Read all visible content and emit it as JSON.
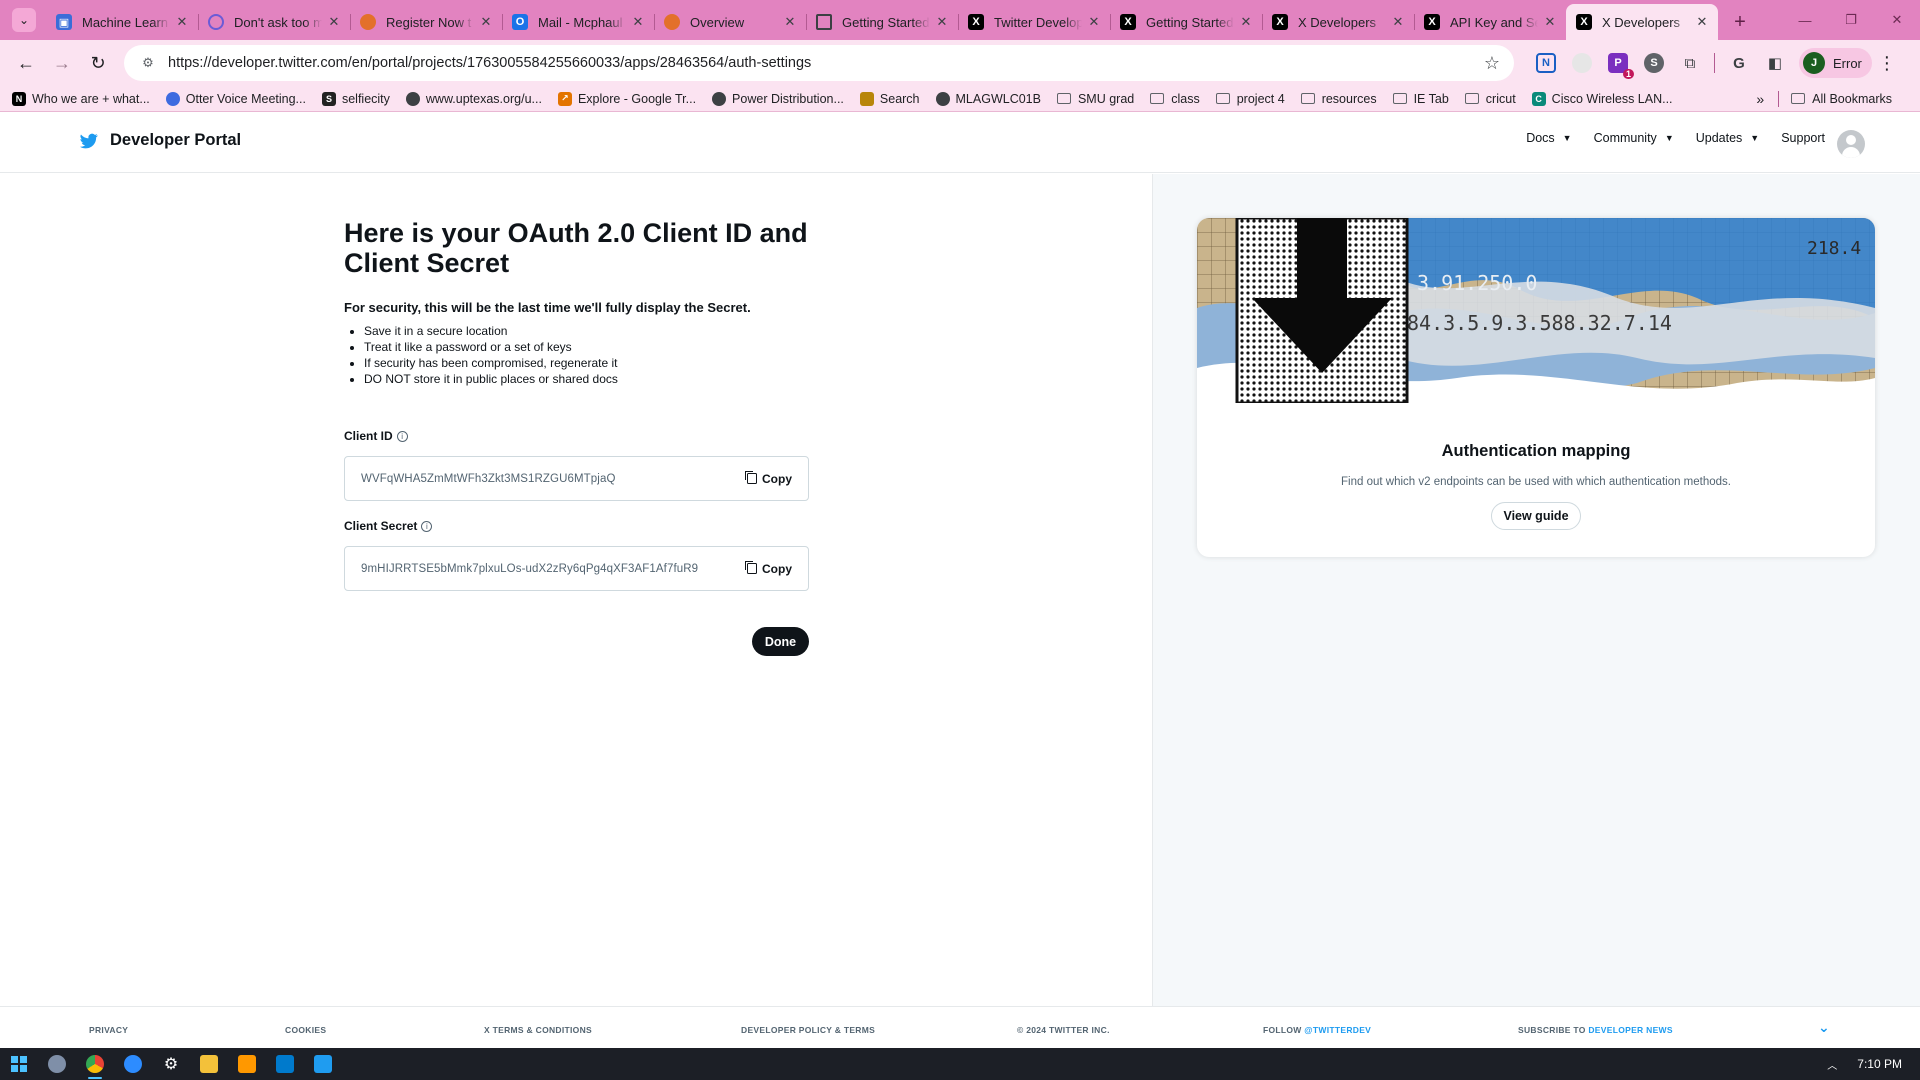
{
  "browser": {
    "tabs": [
      {
        "title": "Machine Learn",
        "icon": "ml-icon",
        "active": false
      },
      {
        "title": "Don't ask too m",
        "icon": "quora-icon",
        "active": false
      },
      {
        "title": "Register Now t",
        "icon": "firefox-icon",
        "active": false
      },
      {
        "title": "Mail - Mcphaul",
        "icon": "outlook-icon",
        "active": false
      },
      {
        "title": "Overview",
        "icon": "firefox-icon",
        "active": false
      },
      {
        "title": "Getting Started",
        "icon": "doc-icon",
        "active": false
      },
      {
        "title": "Twitter Develop",
        "icon": "x-icon",
        "active": false
      },
      {
        "title": "Getting Started",
        "icon": "x-icon",
        "active": false
      },
      {
        "title": "X Developers",
        "icon": "x-icon",
        "active": false
      },
      {
        "title": "API Key and Se",
        "icon": "x-icon",
        "active": false
      },
      {
        "title": "X Developers",
        "icon": "x-icon",
        "active": true
      }
    ],
    "url": "https://developer.twitter.com/en/portal/projects/1763005584255660033/apps/28463564/auth-settings",
    "profile_label": "Error",
    "profile_initial": "J",
    "ext_badge": "1",
    "bookmarks": [
      {
        "label": "Who we are + what...",
        "icon": "notion-icon"
      },
      {
        "label": "Otter Voice Meeting...",
        "icon": "otter-icon"
      },
      {
        "label": "selfiecity",
        "icon": "s-icon"
      },
      {
        "label": "www.uptexas.org/u...",
        "icon": "globe-icon"
      },
      {
        "label": "Explore - Google Tr...",
        "icon": "trends-icon"
      },
      {
        "label": "Power Distribution...",
        "icon": "globe-icon"
      },
      {
        "label": "Search",
        "icon": "search-bm-icon"
      },
      {
        "label": "MLAGWLC01B",
        "icon": "globe-icon"
      },
      {
        "label": "SMU grad",
        "icon": "folder-icon"
      },
      {
        "label": "class",
        "icon": "folder-icon"
      },
      {
        "label": "project 4",
        "icon": "folder-icon"
      },
      {
        "label": "resources",
        "icon": "folder-icon"
      },
      {
        "label": "IE Tab",
        "icon": "folder-icon"
      },
      {
        "label": "cricut",
        "icon": "folder-icon"
      },
      {
        "label": "Cisco Wireless LAN...",
        "icon": "cisco-icon"
      }
    ],
    "all_bookmarks": "All Bookmarks"
  },
  "header": {
    "brand": "Developer Portal",
    "nav": [
      {
        "label": "Docs",
        "has_menu": true
      },
      {
        "label": "Community",
        "has_menu": true
      },
      {
        "label": "Updates",
        "has_menu": true
      },
      {
        "label": "Support",
        "has_menu": false
      }
    ]
  },
  "main": {
    "title": "Here is your OAuth 2.0 Client ID and Client Secret",
    "notice": "For security, this will be the last time we'll fully display the Secret.",
    "bullets": [
      "Save it in a secure location",
      "Treat it like a password or a set of keys",
      "If security has been compromised, regenerate it",
      "DO NOT store it in public places or shared docs"
    ],
    "client_id": {
      "label": "Client ID",
      "value": "WVFqWHA5ZmMtWFh3Zkt3MS1RZGU6MTpjaQ",
      "copy_label": "Copy"
    },
    "client_secret": {
      "label": "Client Secret",
      "value": "9mHIJRRTSE5bMmk7plxuLOs-udX2zRy6qPg4qXF3AF1Af7fuR9",
      "copy_label": "Copy"
    },
    "done_label": "Done"
  },
  "card": {
    "art_numbers_top": "3.91.250.0",
    "art_numbers_bottom": "84.3.5.9.3.588.32.7.14",
    "art_side": "218.4",
    "title": "Authentication mapping",
    "description": "Find out which v2 endpoints can be used with which authentication methods.",
    "button_label": "View guide"
  },
  "footer": {
    "privacy": "PRIVACY",
    "cookies": "COOKIES",
    "terms": "X TERMS & CONDITIONS",
    "policy": "DEVELOPER POLICY & TERMS",
    "copyright": "© 2024 TWITTER INC.",
    "follow_prefix": "FOLLOW",
    "follow_handle": "@TWITTERDEV",
    "subscribe_prefix": "SUBSCRIBE TO",
    "subscribe_link": "DEVELOPER NEWS"
  },
  "taskbar": {
    "clock": "7:10 PM"
  },
  "colors": {
    "tab_strip": "#e283c0",
    "toolbar": "#fbe3f1",
    "twitter_blue": "#1d9bf0",
    "primary_text": "#0f1419",
    "secondary_text": "#536471"
  }
}
